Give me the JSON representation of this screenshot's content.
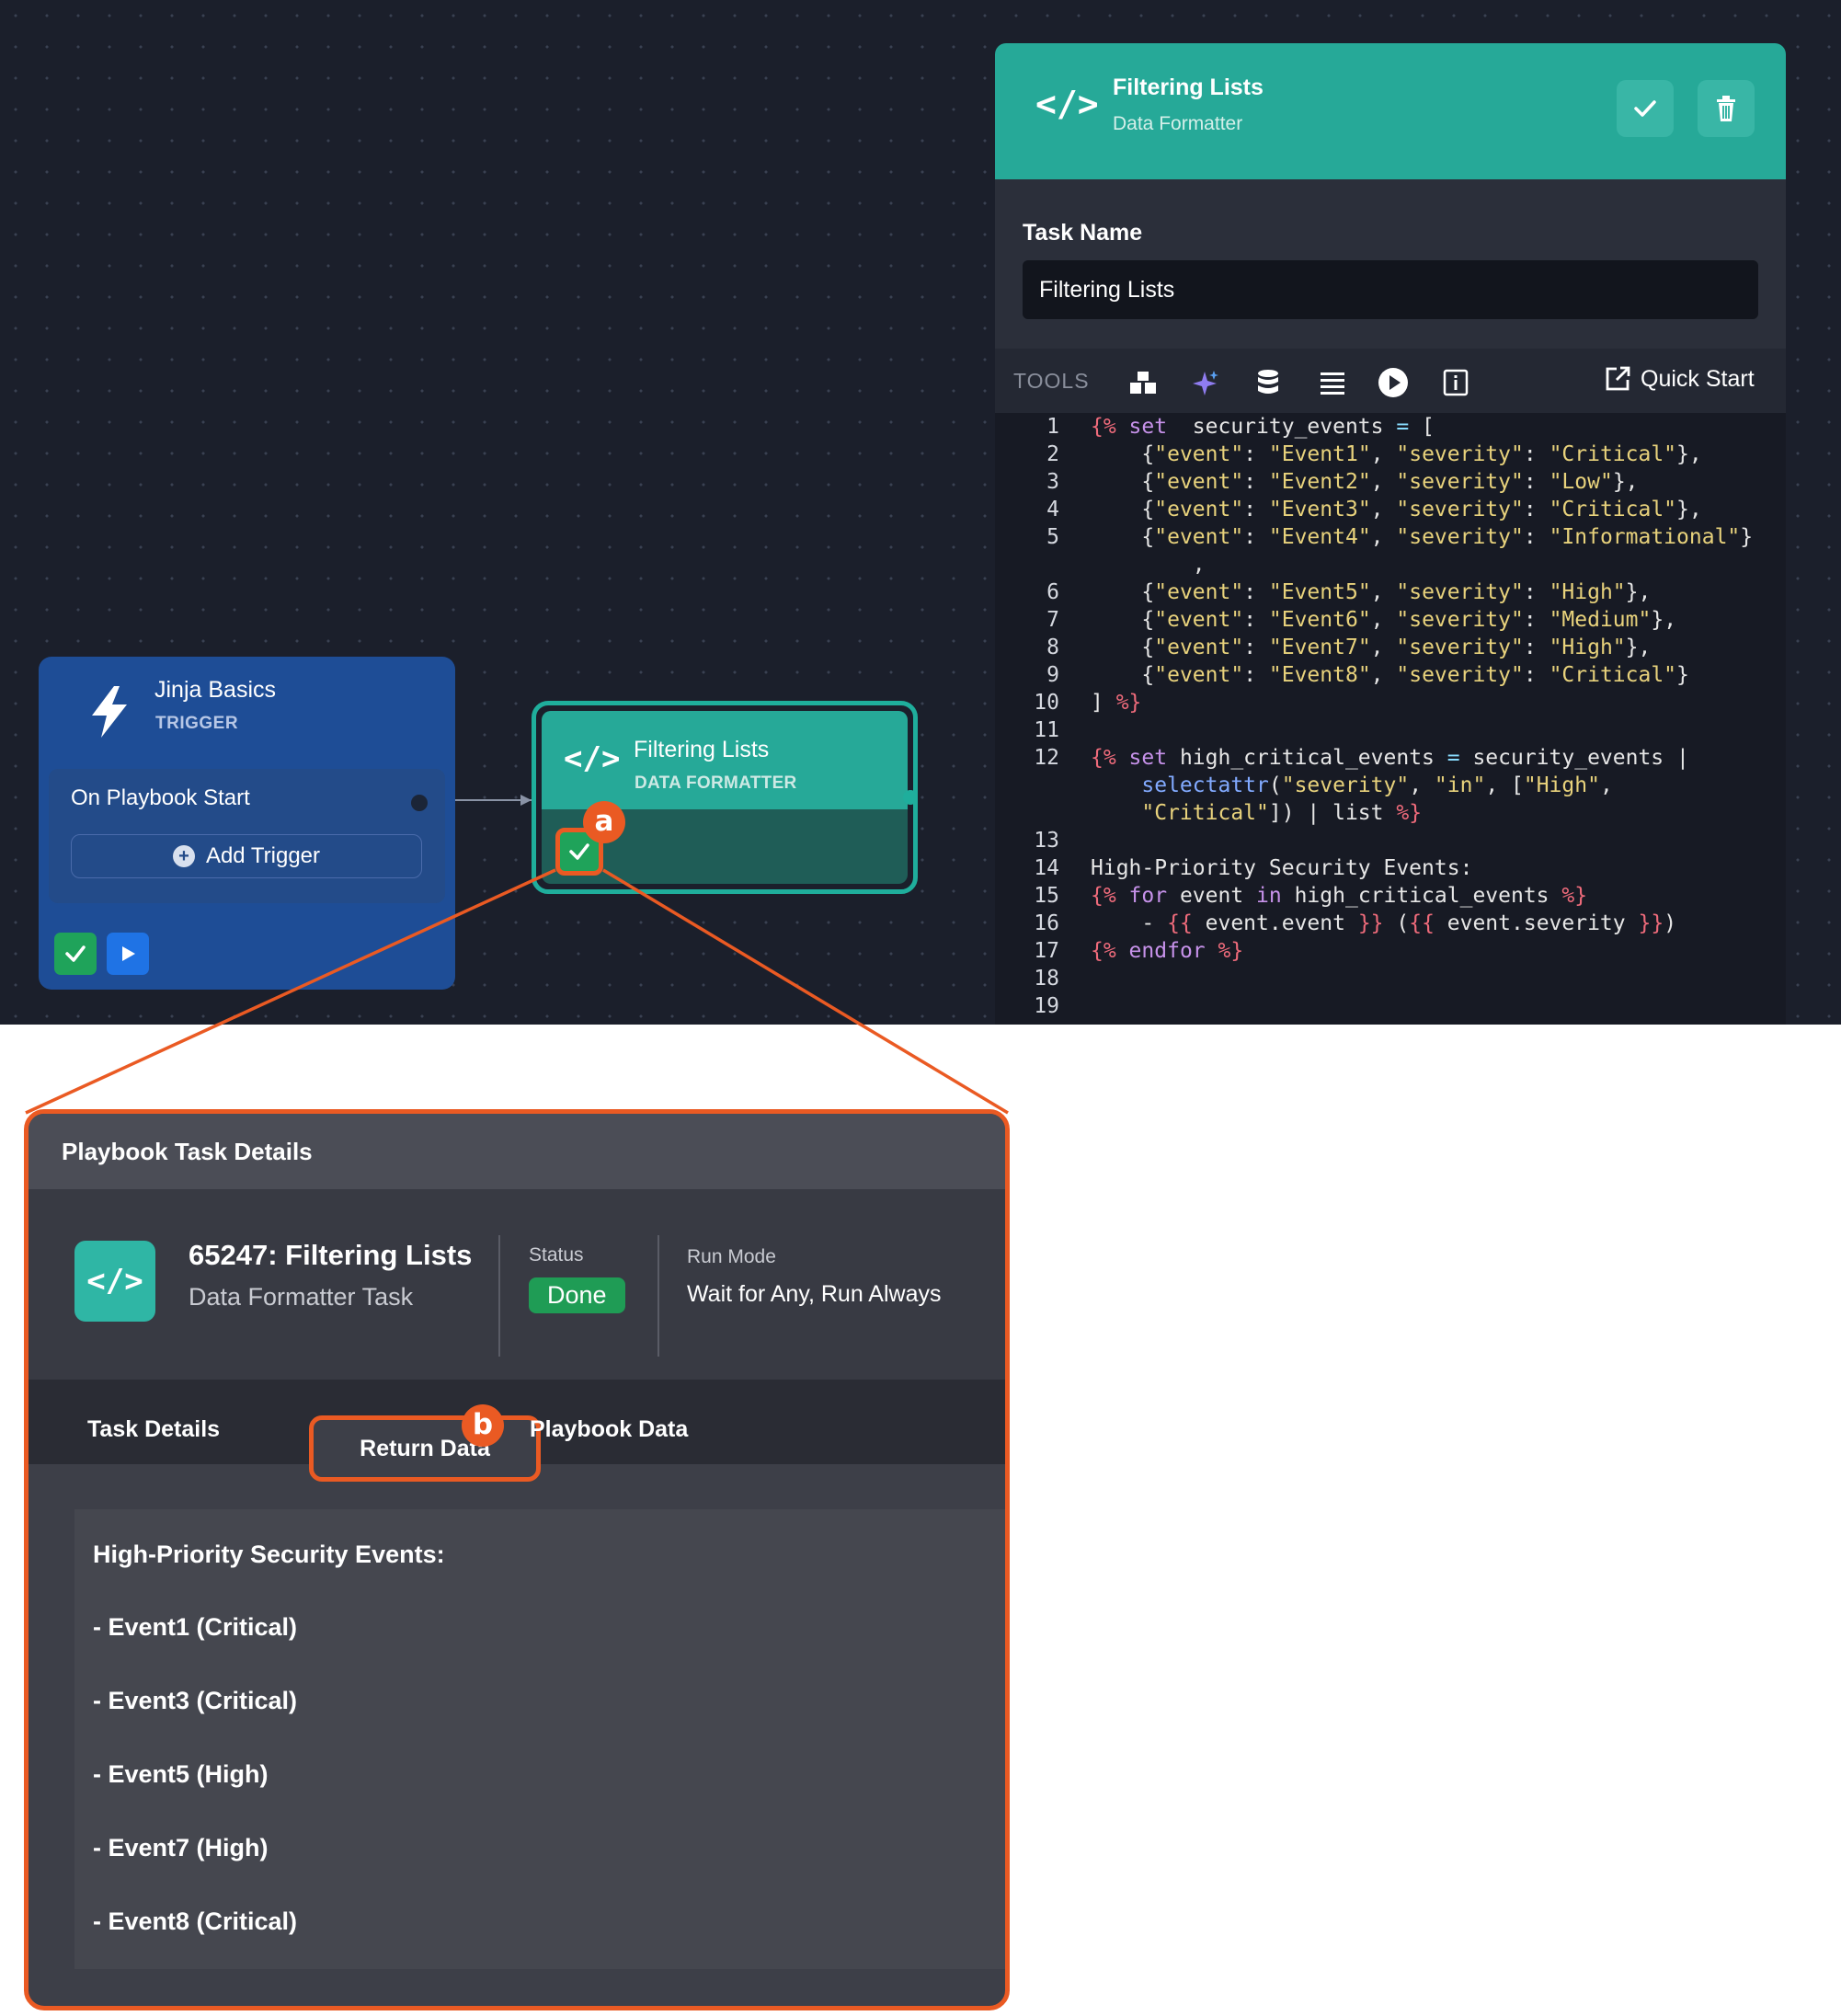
{
  "trigger_node": {
    "title": "Jinja Basics",
    "type": "TRIGGER",
    "event": "On Playbook Start",
    "add_trigger": "Add Trigger"
  },
  "formatter_node": {
    "title": "Filtering Lists",
    "type": "DATA FORMATTER"
  },
  "badges": {
    "a": "a",
    "b": "b"
  },
  "editor": {
    "title": "Filtering Lists",
    "subtitle": "Data Formatter",
    "task_name_label": "Task Name",
    "task_name_value": "Filtering Lists",
    "tools_label": "TOOLS",
    "quick_start": "Quick Start",
    "code_lines": [
      {
        "n": "1",
        "segs": [
          [
            "t-tag",
            "{%"
          ],
          [
            "t-kw",
            " set"
          ],
          [
            "",
            "  security_events "
          ],
          [
            "t-op",
            "="
          ],
          [
            "",
            " ["
          ]
        ]
      },
      {
        "n": "2",
        "segs": [
          [
            "",
            "    {"
          ],
          [
            "t-str",
            "\"event\""
          ],
          [
            "",
            ": "
          ],
          [
            "t-str",
            "\"Event1\""
          ],
          [
            "",
            ", "
          ],
          [
            "t-str",
            "\"severity\""
          ],
          [
            "",
            ": "
          ],
          [
            "t-str",
            "\"Critical\""
          ],
          [
            "",
            "},"
          ]
        ]
      },
      {
        "n": "3",
        "segs": [
          [
            "",
            "    {"
          ],
          [
            "t-str",
            "\"event\""
          ],
          [
            "",
            ": "
          ],
          [
            "t-str",
            "\"Event2\""
          ],
          [
            "",
            ", "
          ],
          [
            "t-str",
            "\"severity\""
          ],
          [
            "",
            ": "
          ],
          [
            "t-str",
            "\"Low\""
          ],
          [
            "",
            "},"
          ]
        ]
      },
      {
        "n": "4",
        "segs": [
          [
            "",
            "    {"
          ],
          [
            "t-str",
            "\"event\""
          ],
          [
            "",
            ": "
          ],
          [
            "t-str",
            "\"Event3\""
          ],
          [
            "",
            ", "
          ],
          [
            "t-str",
            "\"severity\""
          ],
          [
            "",
            ": "
          ],
          [
            "t-str",
            "\"Critical\""
          ],
          [
            "",
            "},"
          ]
        ]
      },
      {
        "n": "5",
        "segs": [
          [
            "",
            "    {"
          ],
          [
            "t-str",
            "\"event\""
          ],
          [
            "",
            ": "
          ],
          [
            "t-str",
            "\"Event4\""
          ],
          [
            "",
            ", "
          ],
          [
            "t-str",
            "\"severity\""
          ],
          [
            "",
            ": "
          ],
          [
            "t-str",
            "\"Informational\""
          ],
          [
            "",
            "}"
          ]
        ]
      },
      {
        "n": "",
        "segs": [
          [
            "",
            "        ,"
          ]
        ]
      },
      {
        "n": "6",
        "segs": [
          [
            "",
            "    {"
          ],
          [
            "t-str",
            "\"event\""
          ],
          [
            "",
            ": "
          ],
          [
            "t-str",
            "\"Event5\""
          ],
          [
            "",
            ", "
          ],
          [
            "t-str",
            "\"severity\""
          ],
          [
            "",
            ": "
          ],
          [
            "t-str",
            "\"High\""
          ],
          [
            "",
            "},"
          ]
        ]
      },
      {
        "n": "7",
        "segs": [
          [
            "",
            "    {"
          ],
          [
            "t-str",
            "\"event\""
          ],
          [
            "",
            ": "
          ],
          [
            "t-str",
            "\"Event6\""
          ],
          [
            "",
            ", "
          ],
          [
            "t-str",
            "\"severity\""
          ],
          [
            "",
            ": "
          ],
          [
            "t-str",
            "\"Medium\""
          ],
          [
            "",
            "},"
          ]
        ]
      },
      {
        "n": "8",
        "segs": [
          [
            "",
            "    {"
          ],
          [
            "t-str",
            "\"event\""
          ],
          [
            "",
            ": "
          ],
          [
            "t-str",
            "\"Event7\""
          ],
          [
            "",
            ", "
          ],
          [
            "t-str",
            "\"severity\""
          ],
          [
            "",
            ": "
          ],
          [
            "t-str",
            "\"High\""
          ],
          [
            "",
            "},"
          ]
        ]
      },
      {
        "n": "9",
        "segs": [
          [
            "",
            "    {"
          ],
          [
            "t-str",
            "\"event\""
          ],
          [
            "",
            ": "
          ],
          [
            "t-str",
            "\"Event8\""
          ],
          [
            "",
            ", "
          ],
          [
            "t-str",
            "\"severity\""
          ],
          [
            "",
            ": "
          ],
          [
            "t-str",
            "\"Critical\""
          ],
          [
            "",
            "}"
          ]
        ]
      },
      {
        "n": "10",
        "segs": [
          [
            "",
            "] "
          ],
          [
            "t-tag",
            "%}"
          ]
        ]
      },
      {
        "n": "11",
        "segs": [
          [
            "",
            ""
          ]
        ]
      },
      {
        "n": "12",
        "segs": [
          [
            "t-tag",
            "{%"
          ],
          [
            "t-kw",
            " set"
          ],
          [
            "",
            " high_critical_events "
          ],
          [
            "t-op",
            "="
          ],
          [
            "",
            " security_events |"
          ]
        ]
      },
      {
        "n": "",
        "segs": [
          [
            "",
            "    "
          ],
          [
            "t-fn",
            "selectattr"
          ],
          [
            "",
            "("
          ],
          [
            "t-str",
            "\"severity\""
          ],
          [
            "",
            ", "
          ],
          [
            "t-str",
            "\"in\""
          ],
          [
            "",
            ", ["
          ],
          [
            "t-str",
            "\"High\""
          ],
          [
            "",
            ","
          ]
        ]
      },
      {
        "n": "",
        "segs": [
          [
            "",
            "    "
          ],
          [
            "t-str",
            "\"Critical\""
          ],
          [
            "",
            "]) | list "
          ],
          [
            "t-tag",
            "%}"
          ]
        ]
      },
      {
        "n": "13",
        "segs": [
          [
            "",
            ""
          ]
        ]
      },
      {
        "n": "14",
        "segs": [
          [
            "",
            "High-Priority Security Events:"
          ]
        ]
      },
      {
        "n": "15",
        "segs": [
          [
            "t-tag",
            "{%"
          ],
          [
            "t-kw",
            " for"
          ],
          [
            "",
            " event "
          ],
          [
            "t-kw",
            "in"
          ],
          [
            "",
            " high_critical_events "
          ],
          [
            "t-tag",
            "%}"
          ]
        ]
      },
      {
        "n": "16",
        "segs": [
          [
            "",
            "    - "
          ],
          [
            "t-tag",
            "{{"
          ],
          [
            "",
            " event.event "
          ],
          [
            "t-tag",
            "}}"
          ],
          [
            "",
            " ("
          ],
          [
            "t-tag",
            "{{"
          ],
          [
            "",
            " event.severity "
          ],
          [
            "t-tag",
            "}}"
          ],
          [
            "",
            ")"
          ]
        ]
      },
      {
        "n": "17",
        "segs": [
          [
            "t-tag",
            "{%"
          ],
          [
            "t-kw",
            " endfor"
          ],
          [
            "t-tag",
            " %}"
          ]
        ]
      },
      {
        "n": "18",
        "segs": [
          [
            "",
            ""
          ]
        ]
      },
      {
        "n": "19",
        "segs": [
          [
            "",
            ""
          ]
        ]
      }
    ]
  },
  "details": {
    "header": "Playbook Task Details",
    "task_title": "65247: Filtering Lists",
    "task_type": "Data Formatter Task",
    "status_label": "Status",
    "status_value": "Done",
    "run_mode_label": "Run Mode",
    "run_mode_value": "Wait for Any, Run Always",
    "tabs": [
      "Task Details",
      "Return Data",
      "Playbook Data"
    ],
    "output_heading": "High-Priority Security Events:",
    "output_items": [
      "- Event1 (Critical)",
      "- Event3 (Critical)",
      "- Event5 (High)",
      "- Event7 (High)",
      "- Event8 (Critical)"
    ]
  },
  "colors": {
    "canvas_bg": "#1b1f2b",
    "teal": "#26a998",
    "trigger_blue": "#1e4d96",
    "highlight_orange": "#ea5a23",
    "done_green": "#1f9c55"
  }
}
